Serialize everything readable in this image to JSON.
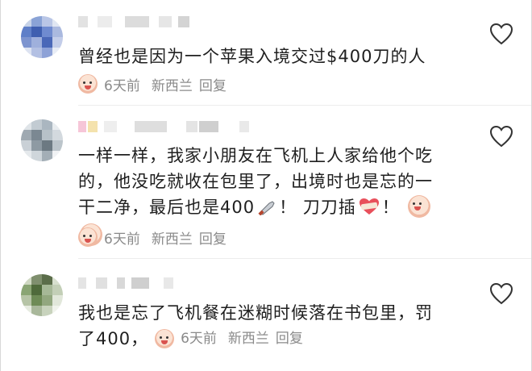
{
  "comments": [
    {
      "text": "曾经也是因为一个苹果入境交过$400刀的人",
      "time": "6天前",
      "location": "新西兰",
      "reply_label": "回复"
    },
    {
      "text_line1": "一样一样，我家小朋友在飞机上人家给他个吃",
      "text_line2": "的，他没吃就收在包里了，出境时也是忘的一",
      "text_line3_a": "干二净，最后也是400",
      "text_line3_b": "！ 刀刀插",
      "text_line3_c": "！",
      "time": "6天前",
      "location": "新西兰",
      "reply_label": "回复"
    },
    {
      "text_line1": "我也是忘了飞机餐在迷糊时候落在书包里，罚",
      "text_line2": "了400，",
      "time": "6天前",
      "location": "新西兰",
      "reply_label": "回复"
    }
  ],
  "icons": {
    "like": "heart-outline-icon",
    "emoji": "crying-face-emoji-icon",
    "knife": "kitchen-knife-icon",
    "heart": "broken-heart-bandage-icon"
  },
  "colors": {
    "meta_text": "#8a8a8a",
    "body_text": "#1f1f1f"
  }
}
